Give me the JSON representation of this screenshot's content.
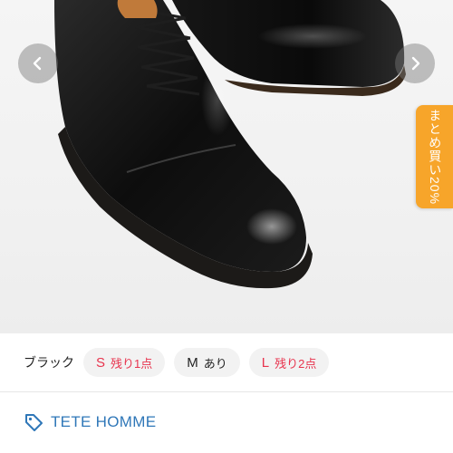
{
  "gallery": {
    "prev_icon": "chevron-left-icon",
    "next_icon": "chevron-right-icon",
    "promo_label": "まとめ買い20%",
    "promo_color": "#f7a52a"
  },
  "variants": {
    "color_label": "ブラック",
    "sizes": [
      {
        "size": "S",
        "stock": "残り1点",
        "status": "low"
      },
      {
        "size": "M",
        "stock": "あり",
        "status": "available"
      },
      {
        "size": "L",
        "stock": "残り2点",
        "status": "low"
      }
    ],
    "low_stock_color": "#e8344e"
  },
  "brand": {
    "name": "TETE HOMME",
    "icon": "tag-icon",
    "color": "#2f77b8"
  }
}
